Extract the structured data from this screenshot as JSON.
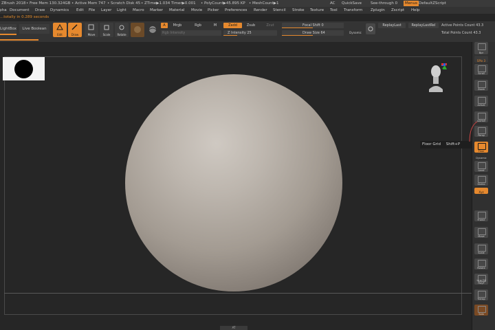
{
  "titlebar": {
    "app": "ZBrush 2018",
    "free_mem": "• Free Mem 130.324GB",
    "active_mem": "• Active Mem 747",
    "scratch": "• Scratch Disk 45",
    "ztime": "• ZTime▶1.034 Timer▶0.001",
    "polycount": "• PolyCount▶45.895 KP",
    "meshcount": "• MeshCount▶1",
    "ac": "AC",
    "quicksave": "QuickSave",
    "seethrough": "See-through 0",
    "menus": "Menus",
    "default_zscript": "DefaultZScript"
  },
  "menu": {
    "items": [
      "Alpha",
      "Document",
      "Draw",
      "Dynamics",
      "Edit",
      "File",
      "Layer",
      "Light",
      "Macro",
      "Marker",
      "Material",
      "Movie",
      "Picker",
      "Preferences",
      "Render",
      "Stencil",
      "Stroke",
      "Texture",
      "Tool",
      "Transform",
      "Zplugin",
      "Zscript",
      "Help"
    ]
  },
  "status_line": "...totally in 0.289 seconds",
  "toolbar": {
    "lightbox": "LightBox",
    "live_boolean": "Live Boolean",
    "edit": "Edit",
    "draw": "Draw",
    "move": "Move",
    "scale": "Scale",
    "rotate": "Rotate",
    "a_label": "A",
    "mrgb": "Mrgb",
    "rgb": "Rgb",
    "m": "M",
    "zadd": "Zadd",
    "zsub": "Zsub",
    "zcut": "Zcut",
    "rgb_intensity": "Rgb Intensity",
    "z_intensity": "Z Intensity 25",
    "focal_shift": "Focal Shift 0",
    "draw_size": "Draw Size 64",
    "dynamic": "Dynamic",
    "replay_last": "ReplayLast",
    "replay_last_rel": "ReplayLastRel",
    "active_points": "Active Points Count 43.3",
    "total_points": "Total Points Count 43.3",
    "z_intensity_level": 0.25,
    "draw_size_level": 0.5,
    "focal_shift_level": 0.5
  },
  "shelf": {
    "buttons": [
      "",
      "Bpr",
      "SPix 3",
      "Scroll",
      "Zoom",
      "Actual",
      "AAHalf",
      "Persp",
      "Floor",
      "Dynamic",
      "Local",
      "Gizmo",
      "Xyz",
      "Frame",
      "Move",
      "Scale",
      "Rotate",
      "Line Fill PolyF",
      "Transp",
      "Solo"
    ]
  },
  "tooltip": {
    "label": "Floor Grid",
    "shortcut": "Shift+P"
  },
  "bottom_tab": "AT",
  "colors": {
    "accent": "#e6892e",
    "background": "#262626",
    "panel": "#343434"
  }
}
